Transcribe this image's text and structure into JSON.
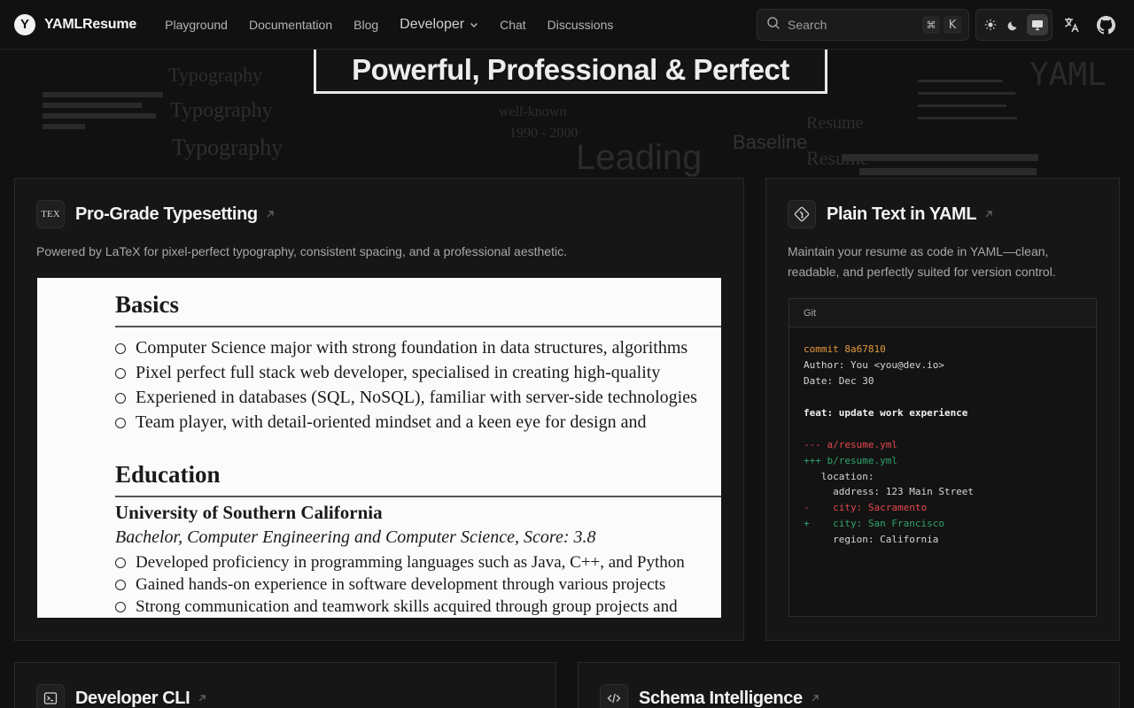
{
  "nav": {
    "brand_letter": "Y",
    "brand": "YAMLResume",
    "links": [
      "Playground",
      "Documentation",
      "Blog",
      "Developer",
      "Chat",
      "Discussions"
    ],
    "search_placeholder": "Search",
    "search_kbd": [
      "⌘",
      "K"
    ]
  },
  "hero": {
    "title": "Powerful, Professional & Perfect",
    "ghost_words": [
      "Typography",
      "Typography",
      "Typography",
      "well-known",
      "1990 - 2000",
      "Leading",
      "Baseline",
      "Resume",
      "Resume",
      "YAML"
    ]
  },
  "cards": {
    "typesetting": {
      "icon_text": "TEX",
      "title": "Pro-Grade Typesetting",
      "desc": "Powered by LaTeX for pixel-perfect typography, consistent spacing, and a professional aesthetic."
    },
    "yaml": {
      "title": "Plain Text in YAML",
      "desc_line1": "Maintain your resume as code in YAML—clean,",
      "desc_line2": "readable, and perfectly suited for version control."
    },
    "cli": {
      "title": "Developer CLI"
    },
    "schema": {
      "title": "Schema Intelligence"
    }
  },
  "resume": {
    "basics_heading": "Basics",
    "basics_items": [
      "Computer Science major with strong foundation in data structures, algorithms",
      "Pixel perfect full stack web developer, specialised in creating high-quality",
      "Experiened in databases (SQL, NoSQL), familiar with server-side technologies",
      "Team player, with detail-oriented mindset and a keen eye for design and"
    ],
    "education_heading": "Education",
    "school": "University of Southern California",
    "degree": "Bachelor, Computer Engineering and Computer Science, Score: 3.8",
    "education_items": [
      "Developed proficiency in programming languages such as Java, C++, and Python",
      "Gained hands-on experience in software development through various projects",
      "Strong communication and teamwork skills acquired through group projects and"
    ]
  },
  "git": {
    "tab": "Git",
    "commit": "commit 8a67810",
    "author": "Author: You <you@dev.io>",
    "date": "Date: Dec 30",
    "message": "feat: update work experience",
    "file_old": "--- a/resume.yml",
    "file_new": "+++ b/resume.yml",
    "ctx1": "   location:",
    "ctx2": "     address: 123 Main Street",
    "removed": "-    city: Sacramento",
    "added": "+    city: San Francisco",
    "ctx3": "     region: California"
  },
  "colors": {
    "background": "#111111",
    "card": "#161616",
    "commit": "#e59a3b",
    "removed": "#e5484d",
    "added": "#30a46c"
  }
}
